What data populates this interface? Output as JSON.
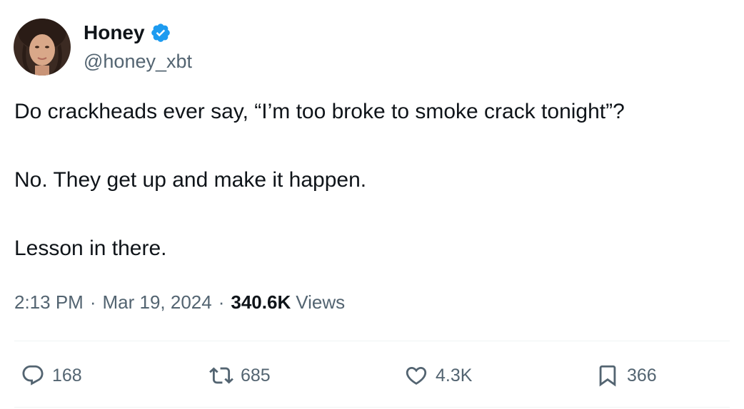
{
  "author": {
    "display_name": "Honey",
    "handle": "@honey_xbt",
    "verified_icon": "verified-badge-icon",
    "avatar_icon": "avatar"
  },
  "tweet": {
    "lines": [
      "Do crackheads ever say, “I’m too broke to smoke crack tonight”?",
      "No. They get up and make it happen.",
      "Lesson in there."
    ]
  },
  "meta": {
    "time": "2:13 PM",
    "separator": "·",
    "date": "Mar 19, 2024",
    "views_count": "340.6K",
    "views_label": "Views"
  },
  "actions": {
    "replies": "168",
    "retweets": "685",
    "likes": "4.3K",
    "bookmarks": "366"
  },
  "colors": {
    "text": "#0f1419",
    "secondary": "#536471",
    "verified": "#1d9bf0",
    "divider": "#eff3f4"
  }
}
